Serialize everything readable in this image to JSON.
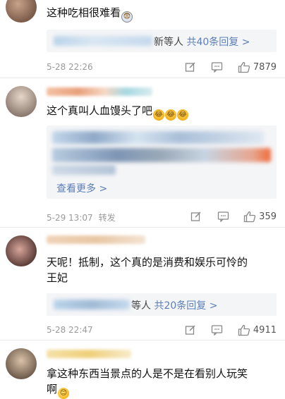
{
  "comments": [
    {
      "text": "这种吃相很难看",
      "reply_prefix": "新等人",
      "reply_count": "共40条回复 >",
      "time": "5-28 22:26",
      "likes": "7879"
    },
    {
      "text": "这个真叫人血馒头了吧",
      "see_more": "查看更多 >",
      "time": "5-29 13:07",
      "repost": "转发",
      "likes": "359"
    },
    {
      "text_line1": "天呢！抵制，这个真的是消费和娱乐可怜的",
      "text_line2": "王妃",
      "reply_prefix": "等人",
      "reply_count": "共20条回复 >",
      "time": "5-28 22:47",
      "likes": "4911"
    },
    {
      "text_line1": "拿这种东西当景点的人是不是在看别人玩笑",
      "text_line2": "啊"
    }
  ],
  "icons": {
    "edit": "edit-icon",
    "comment": "comment-icon",
    "like": "thumbs-up-icon"
  },
  "colors": {
    "link": "#5b7eb8",
    "meta": "#9a9a9a",
    "reply_bg": "#f4f5f7"
  }
}
